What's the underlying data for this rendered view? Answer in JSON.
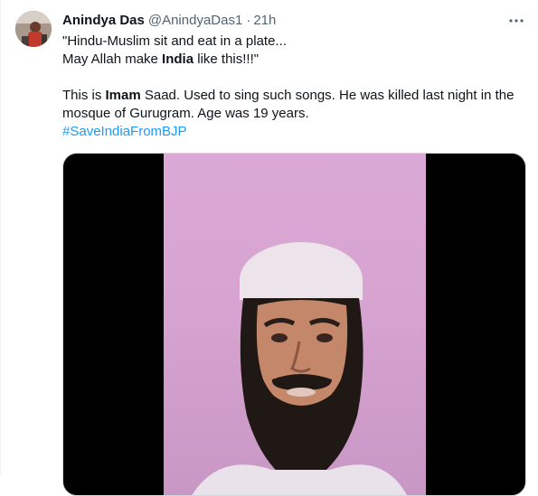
{
  "tweet": {
    "display_name": "Anindya Das",
    "handle": "@AnindyaDas1",
    "separator": "·",
    "time": "21h",
    "lines": {
      "line1": "\"Hindu-Muslim sit and eat in a plate...",
      "line2_before": "May Allah make ",
      "line2_bold": "India",
      "line2_after": " like this!!!\"",
      "line3_before": "This is ",
      "line3_bold": "Imam",
      "line3_after": " Saad. Used to sing such songs. He was killed last night in the",
      "line4": "mosque of Gurugram. Age was 19 years.",
      "hashtag": "#SaveIndiaFromBJP"
    }
  },
  "icons": {
    "more": "more-icon",
    "avatar": "avatar"
  },
  "colors": {
    "text": "#0f1419",
    "secondary": "#536471",
    "link": "#1d9bf0",
    "video_bg": "#d7a3d1"
  }
}
